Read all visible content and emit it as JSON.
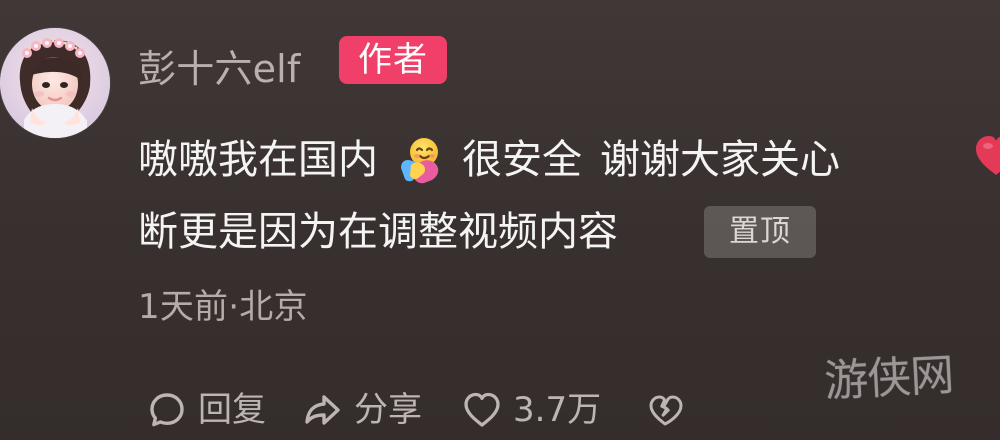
{
  "comment": {
    "username": "彭十六elf",
    "author_badge": "作者",
    "text_line1_part1": "嗷嗷我在国内",
    "text_line1_part2": "很安全",
    "text_line1_part3": "谢谢大家关心",
    "text_line2": "断更是因为在调整视频内容",
    "pinned_badge": "置顶",
    "meta": "1天前·北京",
    "emoji_after_line1_part1": "hugging-face-emoji",
    "emoji_after_line1_part3": "red-heart-emoji"
  },
  "actions": {
    "reply_label": "回复",
    "share_label": "分享",
    "like_count": "3.7万",
    "reply_icon": "reply-icon",
    "share_icon": "share-icon",
    "like_icon": "heart-outline-icon",
    "dislike_icon": "broken-heart-icon"
  },
  "watermark": {
    "text": "游侠网"
  },
  "colors": {
    "background": "#3a3330",
    "author_badge": "#f03f68",
    "heart": "#e53958"
  }
}
